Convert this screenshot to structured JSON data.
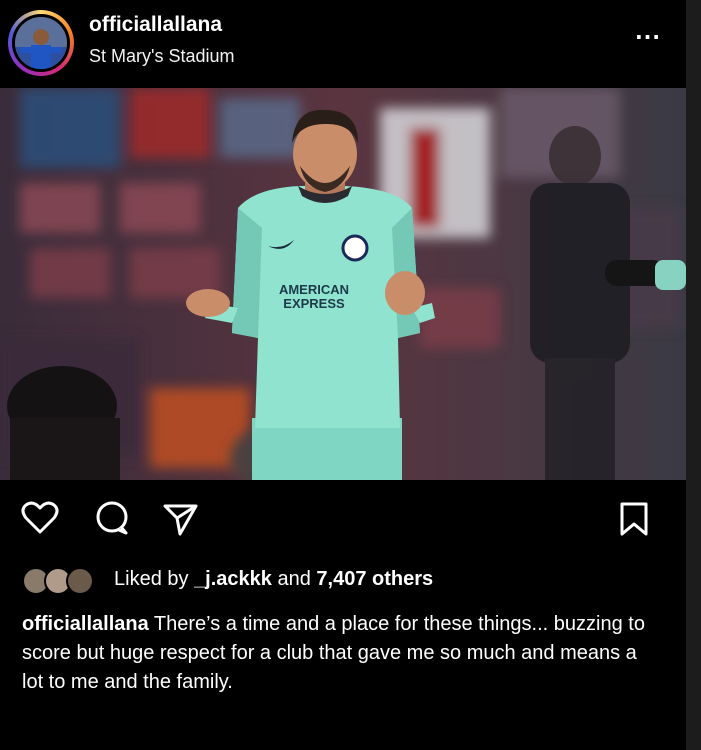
{
  "post": {
    "username": "officiallallana",
    "location": "St Mary's Stadium",
    "more_icon": "⋯",
    "photo": {
      "jersey_sponsor_line1": "AMERICAN",
      "jersey_sponsor_line2": "EXPRESS"
    },
    "actions": {
      "like_icon": "heart-icon",
      "comment_icon": "comment-icon",
      "share_icon": "share-icon",
      "save_icon": "bookmark-icon"
    },
    "likes": {
      "prefix": "Liked by ",
      "user": "_j.ackkk",
      "middle": " and ",
      "count": "7,407 others"
    },
    "caption": {
      "user": "officiallallana",
      "text": " There’s a time and a place for these things... buzzing to score but huge respect for a club that gave me so much and means a lot to me and the family."
    }
  },
  "colors": {
    "background": "#000000",
    "jersey": "#8fe3cf",
    "text": "#ffffff"
  }
}
